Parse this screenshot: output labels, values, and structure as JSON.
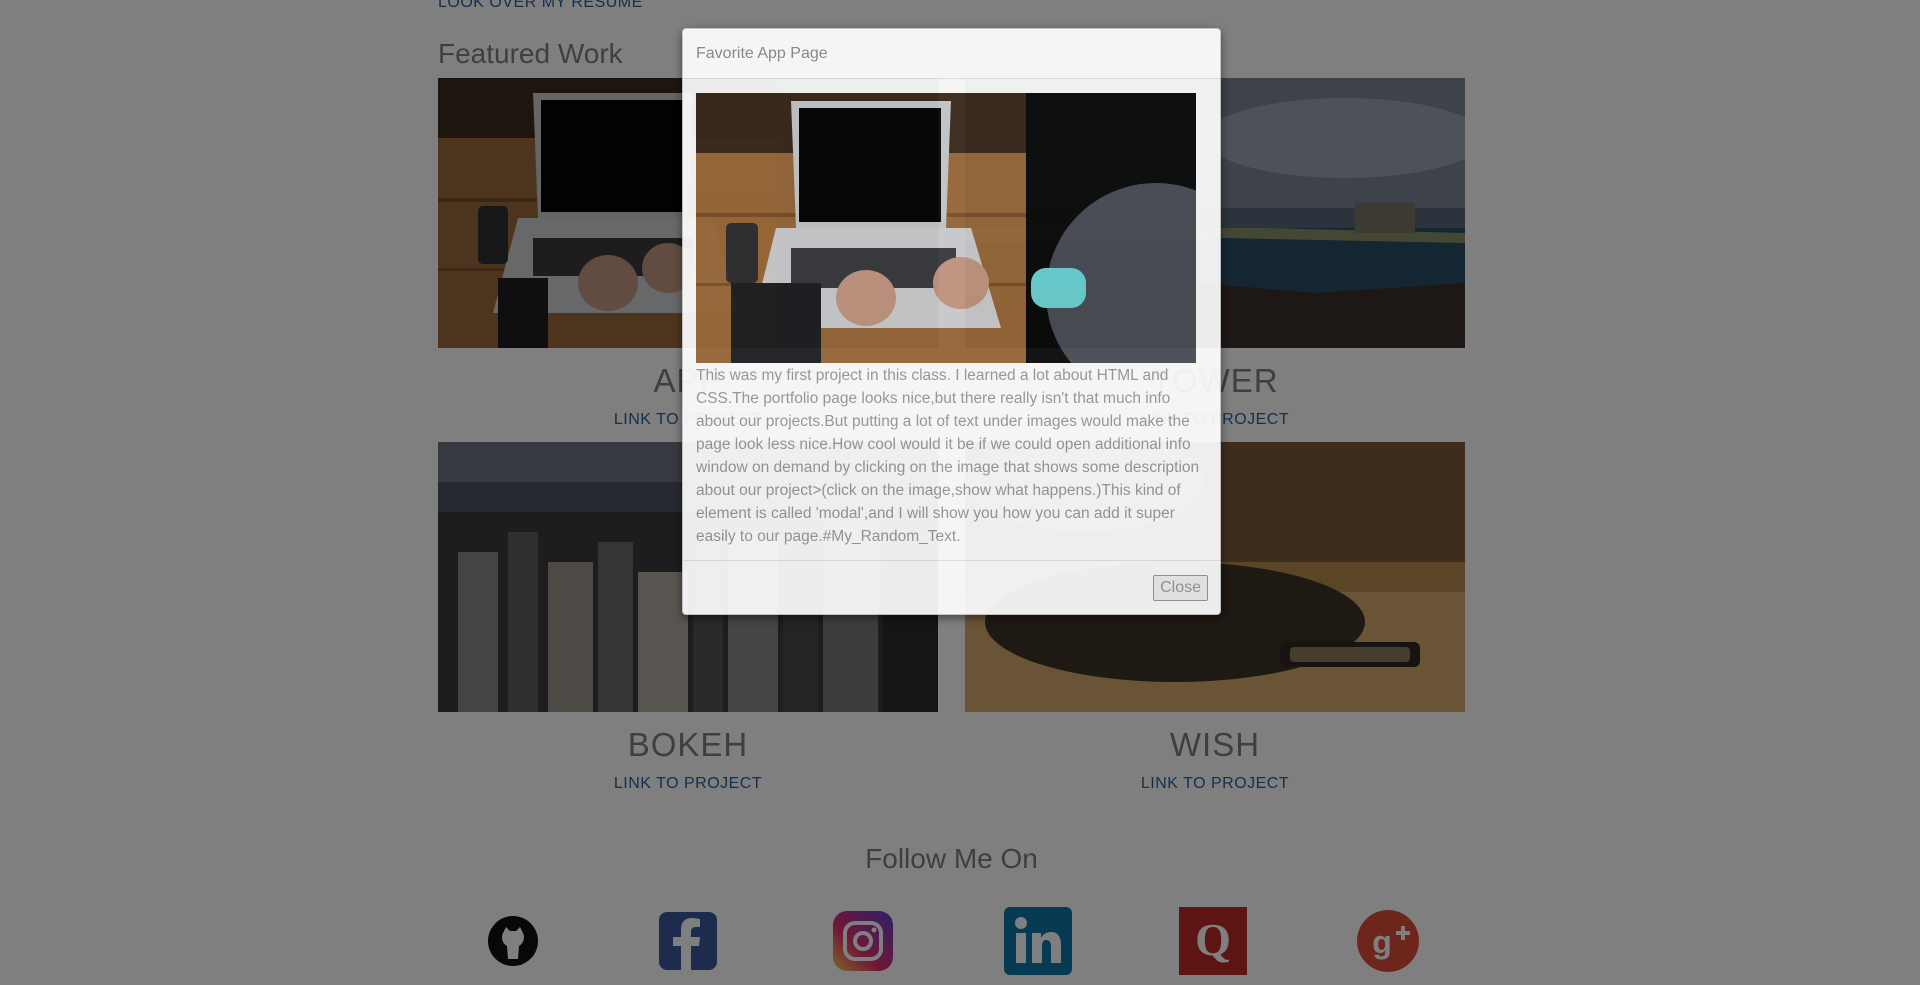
{
  "page": {
    "resume_link": "LOOK OVER MY RESUME",
    "featured_title": "Featured Work",
    "projects": [
      {
        "title": "APP",
        "link": "LINK TO PROJECT"
      },
      {
        "title": "TOWER",
        "link": "LINK TO PROJECT"
      },
      {
        "title": "BOKEH",
        "link": "LINK TO PROJECT"
      },
      {
        "title": "WISH",
        "link": "LINK TO PROJECT"
      }
    ],
    "follow_title": "Follow Me On",
    "social_icons": [
      "github-icon",
      "facebook-icon",
      "instagram-icon",
      "linkedin-icon",
      "quora-icon",
      "google-plus-icon"
    ]
  },
  "modal": {
    "title": "Favorite App Page",
    "body": "This was my first project in this class. I learned a lot about HTML and CSS.The portfolio page looks nice,but there really isn't that much info about our projects.But putting a lot of text under images would make the page look less nice.How cool would it be if we could open additional info window on demand by clicking on the image that shows some description about our project>(click on the image,show what happens.)This kind of element is called 'modal',and I will show you how you can add it super easily to our page.#My_Random_Text.",
    "close_label": "Close"
  },
  "colors": {
    "link": "#2a5f9e",
    "overlay": "rgba(0,0,0,0.5)",
    "facebook": "#3b5998",
    "linkedin": "#0e76a8",
    "quora": "#b92b27",
    "google_plus": "#dd4b39"
  }
}
